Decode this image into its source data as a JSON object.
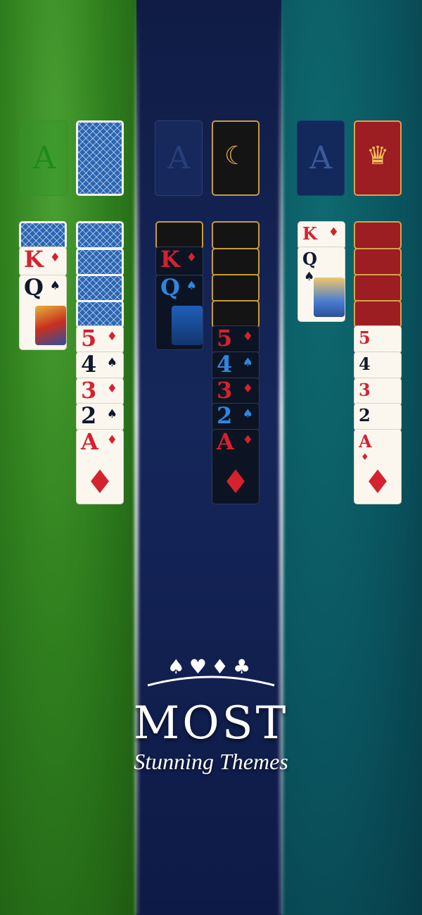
{
  "panels": [
    {
      "name": "Green",
      "color": "#2f7f1e"
    },
    {
      "name": "Navy",
      "color": "#15265a"
    },
    {
      "name": "Teal",
      "color": "#0a5660"
    }
  ],
  "foundation_letter": "A",
  "columns": {
    "left": [
      {
        "rank": "K",
        "suit": "♦"
      },
      {
        "rank": "Q",
        "suit": "♠"
      }
    ],
    "right": [
      {
        "rank": "5",
        "suit": "♦"
      },
      {
        "rank": "4",
        "suit": "♠"
      },
      {
        "rank": "3",
        "suit": "♦"
      },
      {
        "rank": "2",
        "suit": "♠"
      },
      {
        "rank": "A",
        "suit": "♦"
      }
    ]
  },
  "suits_row": "♠♥♦♣",
  "title": "MOST",
  "subtitle": "Stunning Themes",
  "colors": {
    "red": "#d5222f",
    "black": "#10182e",
    "blue": "#2f86e0"
  }
}
